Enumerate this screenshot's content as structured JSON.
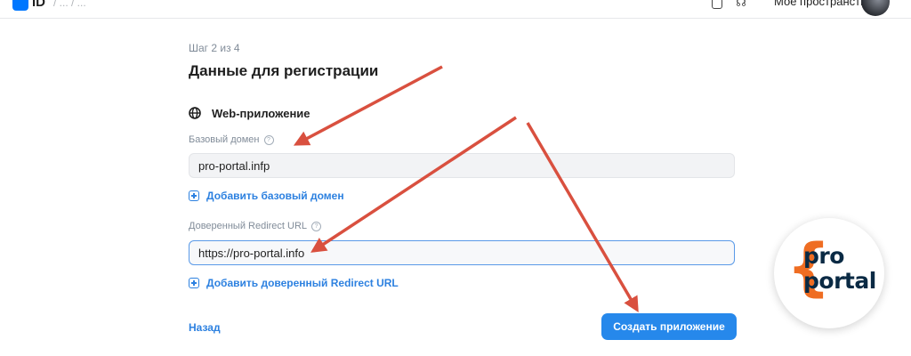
{
  "topbar": {
    "logo_text": "ID",
    "breadcrumb": "/ ... / ...",
    "workspace_label": "Мое пространство"
  },
  "form": {
    "step": "Шаг 2 из 4",
    "title": "Данные для регистрации",
    "section": "Web-приложение",
    "base_domain_label": "Базовый домен",
    "base_domain_value": "pro-portal.infp",
    "add_base_domain": "Добавить базовый домен",
    "redirect_label": "Доверенный Redirect URL",
    "redirect_value": "https://pro-portal.info",
    "add_redirect": "Добавить доверенный Redirect URL",
    "back": "Назад",
    "create": "Создать приложение",
    "help_glyph": "?"
  },
  "badge": {
    "line1": "pro",
    "line2": "portal",
    "brace": "{",
    "brace_color": "#ef6d22",
    "text_color": "#0a2a44"
  },
  "colors": {
    "accent": "#2688eb",
    "link": "#2d81e0",
    "annotation_arrow": "#d9503f"
  }
}
